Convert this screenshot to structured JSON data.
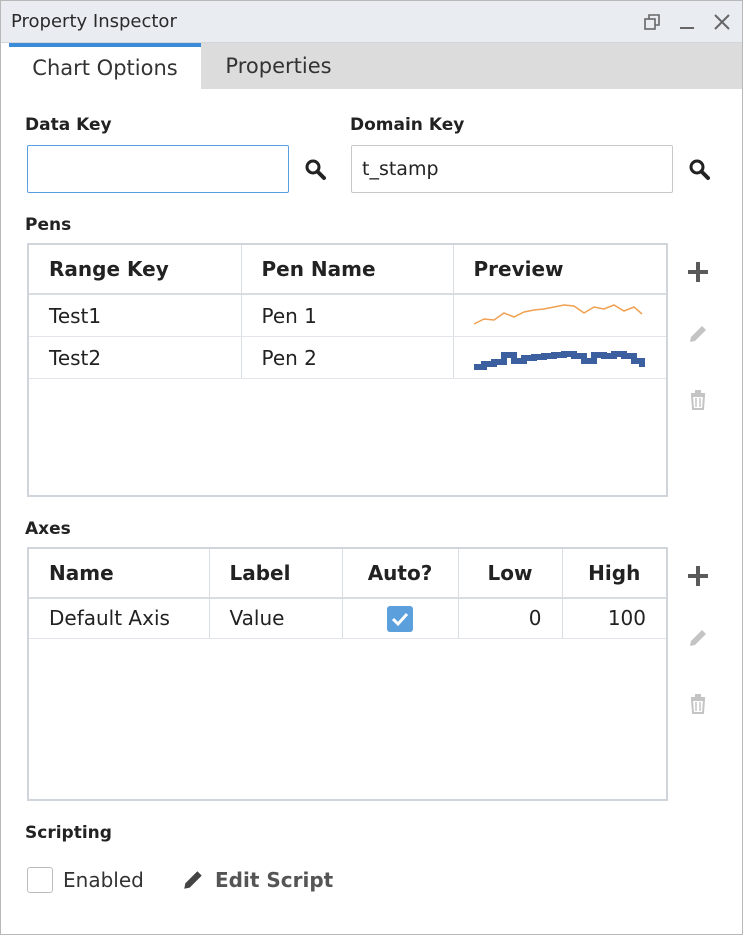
{
  "window": {
    "title": "Property Inspector",
    "restore_icon": "restore-icon",
    "minimize_icon": "minimize-icon",
    "close_icon": "close-icon"
  },
  "tabs": [
    {
      "label": "Chart Options",
      "active": true
    },
    {
      "label": "Properties",
      "active": false
    }
  ],
  "data_key": {
    "label": "Data Key",
    "value": ""
  },
  "domain_key": {
    "label": "Domain Key",
    "value": "t_stamp"
  },
  "pens": {
    "label": "Pens",
    "columns": [
      "Range Key",
      "Pen Name",
      "Preview"
    ],
    "rows": [
      {
        "range_key": "Test1",
        "pen_name": "Pen 1",
        "preview": "line",
        "color": "#f0a050"
      },
      {
        "range_key": "Test2",
        "pen_name": "Pen 2",
        "preview": "step",
        "color": "#3c5fa0"
      }
    ]
  },
  "axes": {
    "label": "Axes",
    "columns": [
      "Name",
      "Label",
      "Auto?",
      "Low",
      "High"
    ],
    "rows": [
      {
        "name": "Default Axis",
        "label": "Value",
        "auto": true,
        "low": "0",
        "high": "100"
      }
    ]
  },
  "scripting": {
    "label": "Scripting",
    "enabled_label": "Enabled",
    "enabled": false,
    "edit_script_label": "Edit Script"
  },
  "colors": {
    "accent": "#3a8bd8",
    "checkbox": "#5b9fdc",
    "add_icon": "#5a5a5a",
    "disabled_icon": "#c4c4c4"
  }
}
